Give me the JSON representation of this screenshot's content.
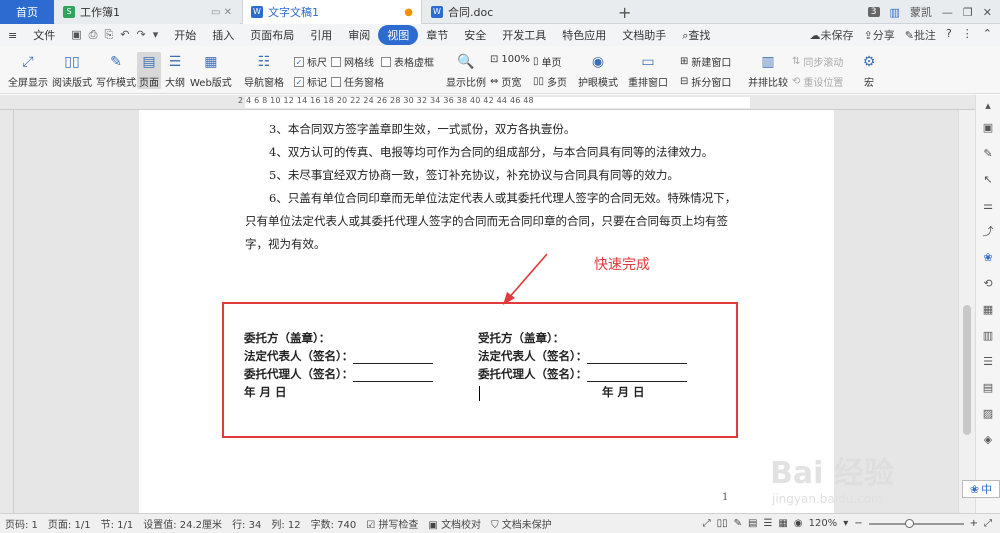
{
  "tabs": {
    "home": "首页",
    "sheet": "工作簿1",
    "doc1": "文字文稿1",
    "doc2": "合同.doc"
  },
  "window": {
    "badge": "3",
    "user": "蒙凯"
  },
  "menubar": {
    "file": "文件",
    "items": [
      "开始",
      "插入",
      "页面布局",
      "引用",
      "审阅",
      "视图",
      "章节",
      "安全",
      "开发工具",
      "特色应用",
      "文档助手"
    ],
    "active": "视图",
    "search": "查找",
    "unsaved": "未保存",
    "share": "分享",
    "comment": "批注",
    "help": "?"
  },
  "ribbon": {
    "fullscreen": "全屏显示",
    "reading": "阅读版式",
    "writing": "写作模式",
    "page": "页面",
    "outline": "大纲",
    "web": "Web版式",
    "navpane": "导航窗格",
    "ruler": "标尺",
    "gridlines": "网格线",
    "tableframe": "表格虚框",
    "mark": "标记",
    "taskpane": "任务窗格",
    "zoom": "显示比例",
    "zoom_value": "100%",
    "single": "单页",
    "pagewidth": "页宽",
    "multi": "多页",
    "eye": "护眼模式",
    "rearrange": "重排窗口",
    "newwin": "新建窗口",
    "split": "拆分窗口",
    "compare": "并排比较",
    "syncscroll": "同步滚动",
    "resetpos": "重设位置",
    "macro": "宏"
  },
  "ruler_numbers": "2  4  6  8  10  12  14  16  18  20  22  24  26  28  30  32  34  36  38  40  42  44  46  48",
  "document": {
    "p3": "3、本合同双方签字盖章即生效，一式贰份，双方各执壹份。",
    "p4": "4、双方认可的传真、电报等均可作为合同的组成部分，与本合同具有同等的法律效力。",
    "p5": "5、未尽事宜经双方协商一致，签订补充协议，补充协议与合同具有同等的效力。",
    "p6": "6、只盖有单位合同印章而无单位法定代表人或其委托代理人签字的合同无效。特殊情况下，只有单位法定代表人或其委托代理人签字的合同而无合同印章的合同，只要在合同每页上均有签字，视为有效。",
    "annotation": "快速完成",
    "left_sig": [
      "委托方（盖章）：",
      "法定代表人（签名）：",
      "委托代理人（签名）：",
      "年    月    日"
    ],
    "right_sig": [
      "受托方（盖章）：",
      "法定代表人（签名）：",
      "委托代理人（签名）：",
      "年    月    日"
    ],
    "page_number": "1"
  },
  "status": {
    "page_no": "页码: 1",
    "pages": "页面: 1/1",
    "section": "节: 1/1",
    "setting": "设置值: 24.2厘米",
    "row": "行: 34",
    "col": "列: 12",
    "words": "字数: 740",
    "spell": "拼写检查",
    "proof": "文档校对",
    "protect": "文档未保护",
    "zoom": "120%"
  },
  "watermark": {
    "main": "Bai 经验",
    "sub": "jingyan.baidu.com"
  },
  "ime": "中",
  "colors": {
    "accent": "#2e6bd1",
    "annotation": "#e23a3a"
  }
}
